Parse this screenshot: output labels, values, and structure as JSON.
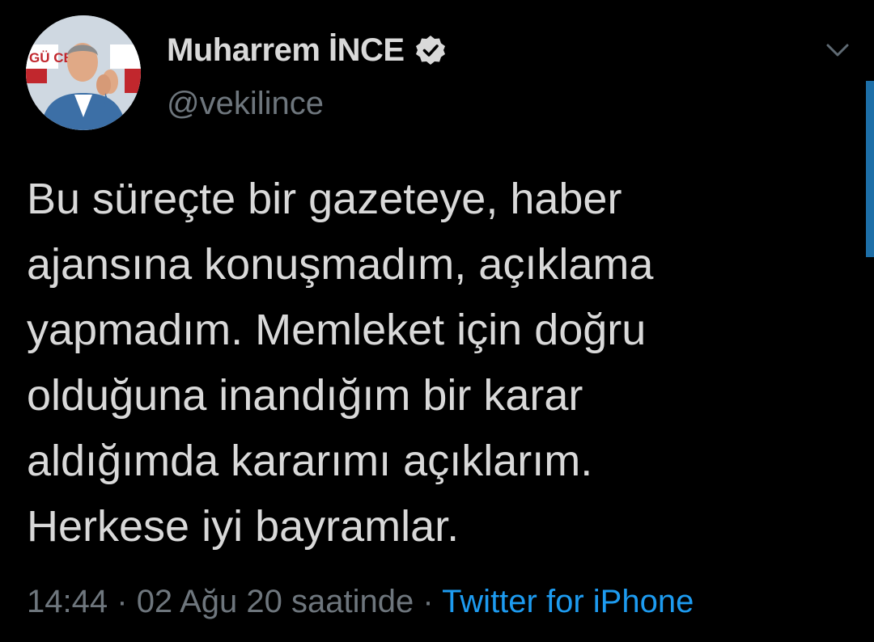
{
  "author": {
    "display_name": "Muharrem İNCE",
    "handle": "@vekilince",
    "verified": true,
    "avatar_icon": "profile-photo",
    "avatar_banner_text": "GÜ CE"
  },
  "tweet": {
    "lines": [
      "Bu süreçte bir gazeteye, haber",
      "ajansına konuşmadım, açıklama",
      "yapmadım. Memleket için doğru",
      "olduğuna inandığım bir karar",
      "aldığımda kararımı açıklarım.",
      "Herkese iyi bayramlar."
    ]
  },
  "meta": {
    "time": "14:44",
    "separator": "·",
    "date": "02 Ağu 20 saatinde",
    "source": "Twitter for iPhone"
  },
  "icons": {
    "more": "chevron-down-icon",
    "verified": "verified-badge-icon"
  },
  "colors": {
    "background": "#000000",
    "text": "#d9d9d9",
    "secondary": "#6e767d",
    "link": "#1d9bf0"
  }
}
